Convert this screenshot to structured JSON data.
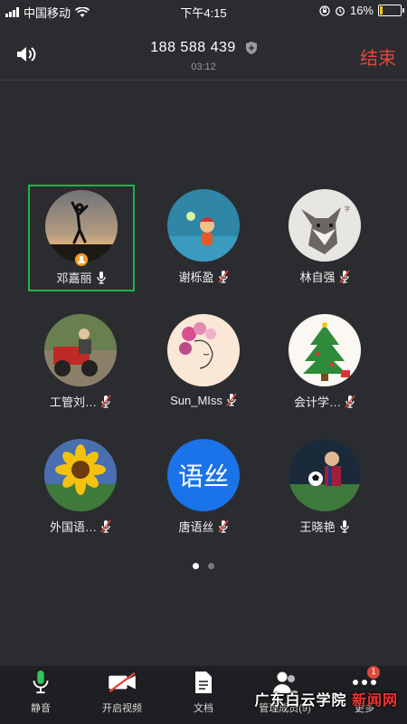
{
  "status_bar": {
    "carrier": "中国移动",
    "time": "下午4:15",
    "battery": "16%",
    "battery_level": 0.16,
    "icons": [
      "signal-icon",
      "wifi-icon",
      "lock-rotation-icon",
      "alarm-icon",
      "battery-icon"
    ]
  },
  "header": {
    "number": "188 588 439",
    "timer": "03:12",
    "end_label": "结束",
    "end_color": "#e2473c"
  },
  "members": [
    {
      "name": "邓嘉丽",
      "mic": "on",
      "host": true,
      "selected": true,
      "avatar": "silhouette-sunset"
    },
    {
      "name": "谢栎盈",
      "mic": "off",
      "host": false,
      "avatar": "cartoon-boy"
    },
    {
      "name": "林自强",
      "mic": "off",
      "host": false,
      "avatar": "wolf"
    },
    {
      "name": "工管刘…",
      "mic": "off",
      "host": false,
      "avatar": "man-on-tricycle"
    },
    {
      "name": "Sun_MIss",
      "mic": "off",
      "host": false,
      "avatar": "girl-with-flowers"
    },
    {
      "name": "会计学…",
      "mic": "off",
      "host": false,
      "avatar": "christmas-tree"
    },
    {
      "name": "外国语…",
      "mic": "off",
      "host": false,
      "avatar": "sunflower"
    },
    {
      "name": "唐语丝",
      "mic": "off",
      "host": false,
      "avatar_text": "语丝",
      "avatar_color": "#1a73e8"
    },
    {
      "name": "王晓艳",
      "mic": "on",
      "host": false,
      "avatar": "boy-soccer"
    }
  ],
  "pager": {
    "pages": 2,
    "current": 1
  },
  "toolbar": {
    "items": [
      {
        "label": "静音",
        "icon": "microphone-icon"
      },
      {
        "label": "开启视频",
        "icon": "video-off-icon"
      },
      {
        "label": "文档",
        "icon": "document-icon"
      },
      {
        "label": "管理成员(9)",
        "icon": "members-icon"
      },
      {
        "label": "更多",
        "icon": "more-icon",
        "badge": "1"
      }
    ]
  },
  "watermark": {
    "left": "广东白云学院",
    "right": "新闻网"
  }
}
